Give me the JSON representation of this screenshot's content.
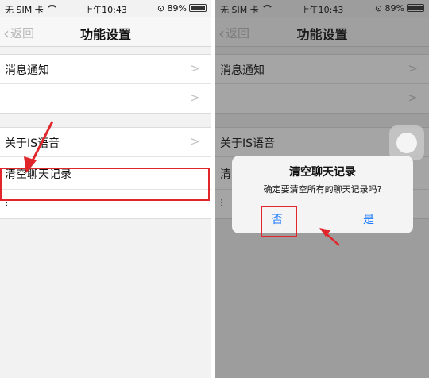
{
  "status_bar": {
    "carrier": "无 SIM 卡",
    "time": "上午10:43",
    "battery": "89%"
  },
  "nav": {
    "back_label": "返回",
    "title": "功能设置"
  },
  "settings": {
    "notifications": "消息通知",
    "about_voice": "关于IS语音",
    "clear_history": "清空聊天记录",
    "partial_row": "清"
  },
  "dialog": {
    "title": "清空聊天记录",
    "message": "确定要清空所有的聊天记录吗?",
    "no_label": "否",
    "yes_label": "是"
  },
  "colors": {
    "accent": "#1a7aff",
    "annotation": "#e0262a"
  }
}
